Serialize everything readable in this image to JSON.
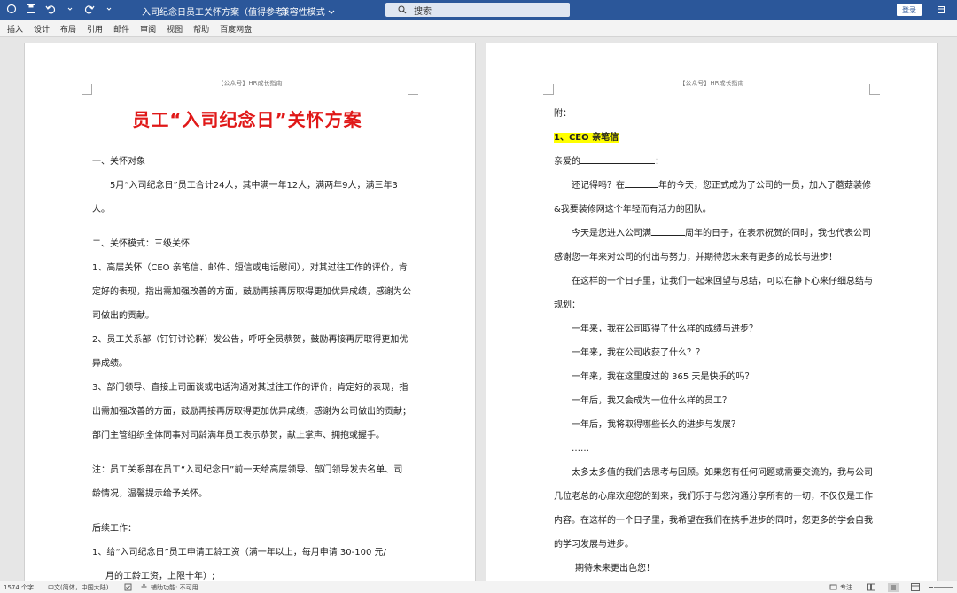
{
  "titlebar": {
    "doc_title": "入司纪念日员工关怀方案（值得参考）",
    "mode": "- 兼容性模式",
    "search_placeholder": "搜索",
    "login": "登录"
  },
  "ribbon": {
    "tabs": [
      "插入",
      "设计",
      "布局",
      "引用",
      "邮件",
      "审阅",
      "视图",
      "帮助",
      "百度网盘"
    ]
  },
  "header_text": "【公众号】HR成长指南",
  "left_page": {
    "title": "员工“入司纪念日”关怀方案",
    "sec1": "一、关怀对象",
    "sec1_p": "5月“入司纪念日”员工合计24人，其中满一年12人，满两年9人，满三年3人。",
    "sec2": "二、关怀模式：三级关怀",
    "item1": "1、高层关怀（CEO 亲笔信、邮件、短信或电话慰问），对其过往工作的评价，肯定好的表现，指出需加强改善的方面，鼓励再接再厉取得更加优异成绩，感谢为公司做出的贡献。",
    "item2": "2、员工关系部（钉钉讨论群）发公告，呼吁全员恭贺，鼓励再接再厉取得更加优异成绩。",
    "item3": "3、部门领导、直接上司面谈或电话沟通对其过往工作的评价，肯定好的表现，指出需加强改善的方面，鼓励再接再厉取得更加优异成绩，感谢为公司做出的贡献；部门主管组织全体同事对司龄满年员工表示恭贺，献上掌声、拥抱或握手。",
    "note": "注：员工关系部在员工“入司纪念日”前一天给高层领导、部门领导发去名单、司龄情况，温馨提示给予关怀。",
    "follow": "后续工作：",
    "follow1a": "1、给“入司纪念日”员工申请工龄工资（满一年以上，每月申请 30-100 元/",
    "follow1b": "月的工龄工资，上限十年）;"
  },
  "right_page": {
    "fu": "附：",
    "letter_title": "1、CEO 亲笔信",
    "dear_a": "亲爱的",
    "dear_b": "：",
    "p1a": "还记得吗？在",
    "p1b": "年的今天，您正式成为了公司的一员，加入了蘑菇装修&我要装修网这个年轻而有活力的团队。",
    "p2a": "今天是您进入公司满",
    "p2b": "周年的日子，在表示祝贺的同时，我也代表公司感谢您一年来对公司的付出与努力，并期待您未来有更多的成长与进步！",
    "p3": "在这样的一个日子里，让我们一起来回望与总结，可以在静下心来仔细总结与规划：",
    "q1": "一年来，我在公司取得了什么样的成绩与进步？",
    "q2": "一年来，我在公司收获了什么？？",
    "q3": "一年来，我在这里度过的 365 天是快乐的吗？",
    "q4": "一年后，我又会成为一位什么样的员工？",
    "q5": "一年后，我将取得哪些长久的进步与发展？",
    "dots": "……",
    "p4": "太多太多值的我们去思考与回顾。如果您有任何问题或需要交流的，我与公司几位老总的心扉欢迎您的到来，我们乐于与您沟通分享所有的一切，不仅仅是工作内容。在这样的一个日子里，我希望在我们在携手进步的同时，您更多的学会自我的学习发展与进步。",
    "p5": "期待未来更出色您！"
  },
  "statusbar": {
    "words": "1574 个字",
    "lang": "中文(简体，中国大陆)",
    "access": "辅助功能: 不可用",
    "focus": "专注"
  }
}
